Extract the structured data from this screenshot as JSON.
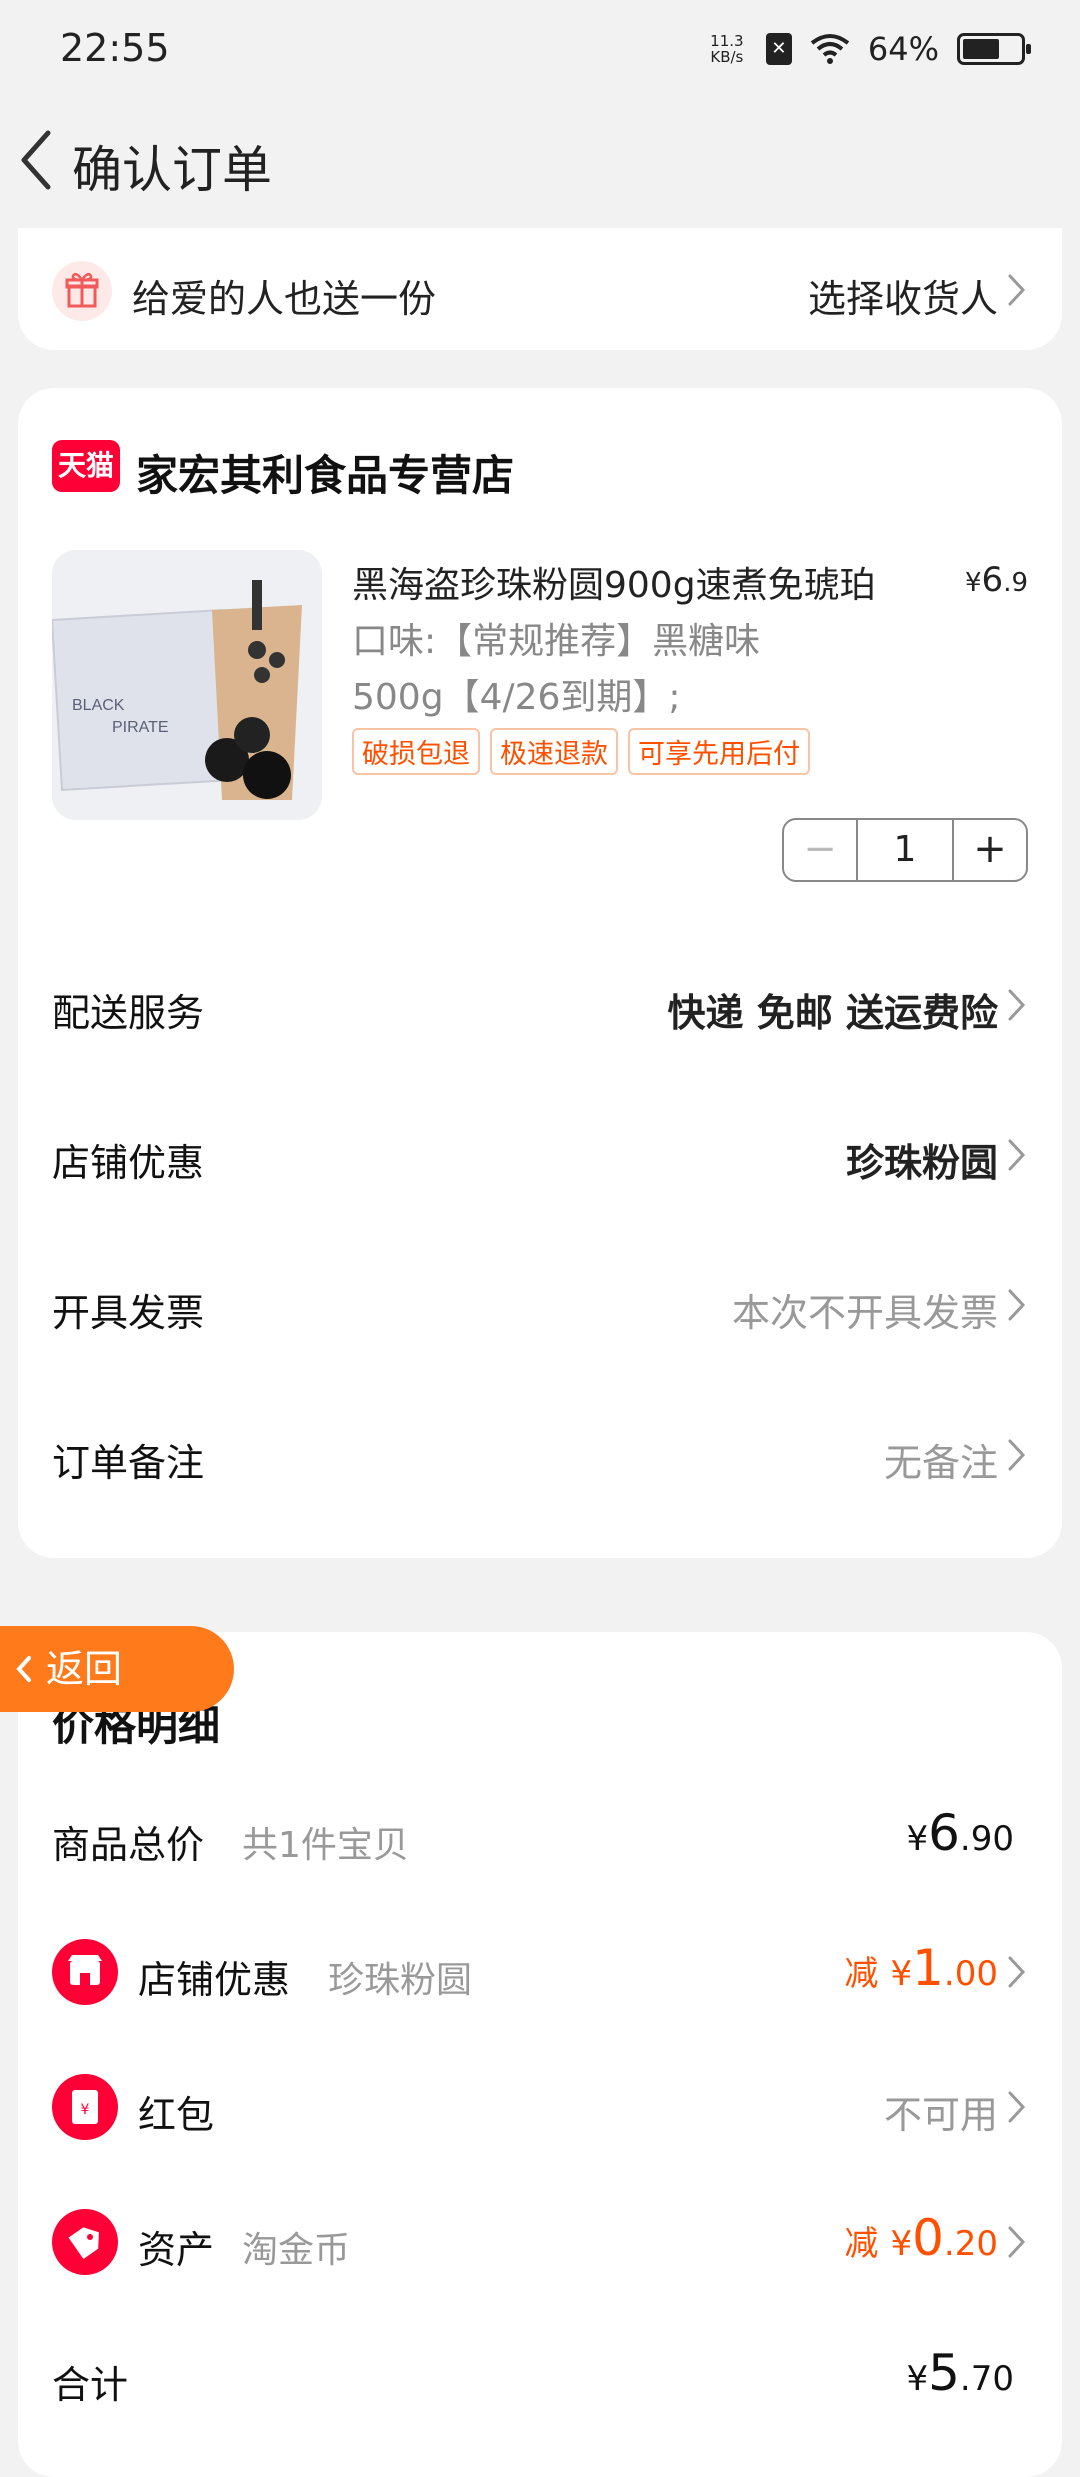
{
  "status_bar": {
    "time": "22:55",
    "net_speed": "11.3",
    "net_unit": "KB/s",
    "battery_percent": "64%",
    "battery_level": 0.64
  },
  "header": {
    "title": "确认订单"
  },
  "gift": {
    "label": "给爱的人也送一份",
    "action": "选择收货人"
  },
  "store": {
    "badge": "天猫",
    "name": "家宏其利食品专营店",
    "product": {
      "title": "黑海盗珍珠粉圆900g速煮免琥珀",
      "price_symbol": "¥",
      "price_int": "6",
      "price_dec": ".9",
      "spec_line1": "口味:【常规推荐】黑糖味",
      "spec_line2": "500g【4/26到期】;",
      "tags": [
        "破损包退",
        "极速退款",
        "可享先用后付"
      ],
      "quantity": "1",
      "minus": "−",
      "plus": "+"
    },
    "rows": [
      {
        "label": "配送服务",
        "value": "快递 免邮 送运费险"
      },
      {
        "label": "店铺优惠",
        "value": "珍珠粉圆"
      },
      {
        "label": "开具发票",
        "value": "本次不开具发票"
      },
      {
        "label": "订单备注",
        "value": "无备注"
      }
    ]
  },
  "price_detail": {
    "title": "价格明细",
    "total_goods": {
      "label": "商品总价",
      "sub": "共1件宝贝",
      "yen": "¥",
      "int": "6",
      "dec": ".90"
    },
    "store_discount": {
      "label": "店铺优惠",
      "sub": "珍珠粉圆",
      "prefix": "减",
      "yen": "¥",
      "int": "1",
      "dec": ".00"
    },
    "red_packet": {
      "label": "红包",
      "value": "不可用",
      "icon_glyph": "¥"
    },
    "assets": {
      "label": "资产",
      "sub": "淘金币",
      "prefix": "减",
      "yen": "¥",
      "int": "0",
      "dec": ".20"
    },
    "total": {
      "label": "合计",
      "yen": "¥",
      "int": "5",
      "dec": ".70"
    }
  },
  "float_back": {
    "label": "返回"
  },
  "colors": {
    "accent": "#ff5000",
    "tmall": "#ff0036",
    "float": "#ff7a1a"
  }
}
